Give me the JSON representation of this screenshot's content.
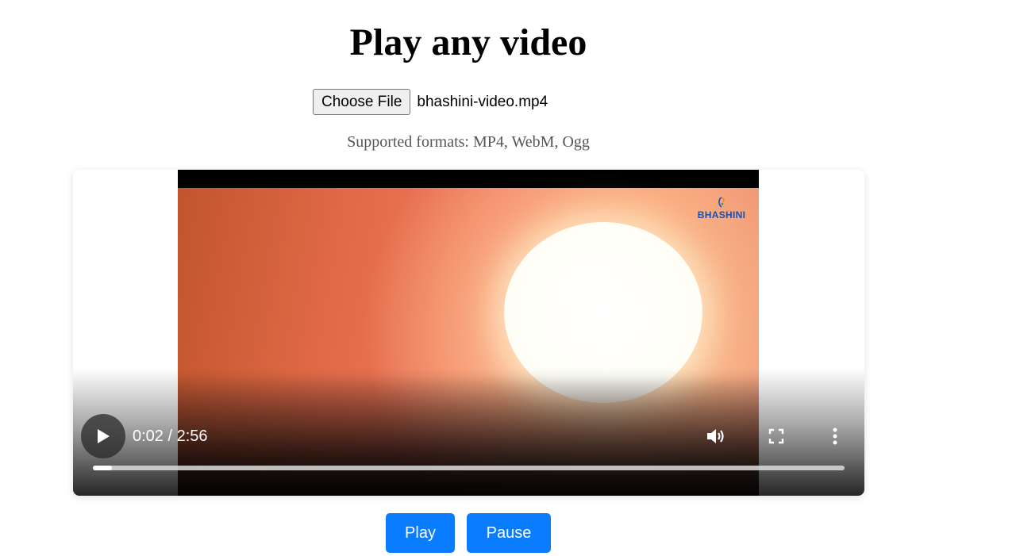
{
  "header": {
    "title": "Play any video"
  },
  "file_input": {
    "button_label": "Choose File",
    "file_name": "bhashini-video.mp4"
  },
  "formats_note": "Supported formats: MP4, WebM, Ogg",
  "video": {
    "brand_label": "BHASHINI",
    "time_display": "0:02 / 2:56",
    "progress": 0.011,
    "icons": {
      "play": "play-icon",
      "volume": "volume-icon",
      "fullscreen": "fullscreen-icon",
      "more": "more-options-icon"
    }
  },
  "buttons": {
    "play_label": "Play",
    "pause_label": "Pause"
  },
  "colors": {
    "accent": "#0a7cff",
    "brand": "#1b4fae"
  }
}
